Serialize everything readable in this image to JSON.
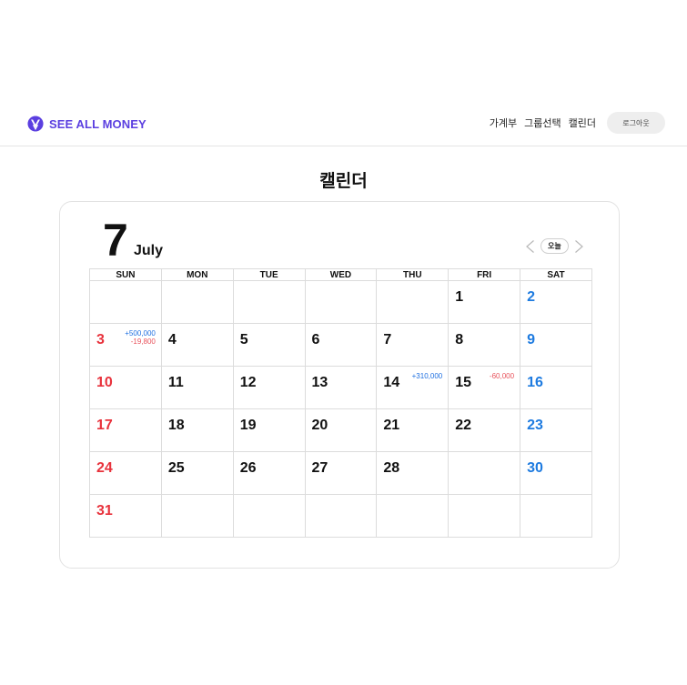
{
  "header": {
    "brand": "SEE ALL MONEY",
    "nav": [
      "가계부",
      "그룹선택",
      "캘린더"
    ],
    "logout_label": "로그아웃",
    "brand_color": "#5b3fe0"
  },
  "page_title": "캘린더",
  "calendar": {
    "month_number": "7",
    "month_name": "July",
    "today_label": "오늘",
    "weekdays": [
      "SUN",
      "MON",
      "TUE",
      "WED",
      "THU",
      "FRI",
      "SAT"
    ],
    "weeks": [
      [
        {
          "day": ""
        },
        {
          "day": ""
        },
        {
          "day": ""
        },
        {
          "day": ""
        },
        {
          "day": ""
        },
        {
          "day": "1"
        },
        {
          "day": "2"
        }
      ],
      [
        {
          "day": "3",
          "income": "+500,000",
          "expense": "-19,800"
        },
        {
          "day": "4"
        },
        {
          "day": "5"
        },
        {
          "day": "6"
        },
        {
          "day": "7"
        },
        {
          "day": "8"
        },
        {
          "day": "9"
        }
      ],
      [
        {
          "day": "10"
        },
        {
          "day": "11"
        },
        {
          "day": "12"
        },
        {
          "day": "13"
        },
        {
          "day": "14",
          "income": "+310,000"
        },
        {
          "day": "15",
          "expense": "-60,000"
        },
        {
          "day": "16"
        }
      ],
      [
        {
          "day": "17"
        },
        {
          "day": "18"
        },
        {
          "day": "19"
        },
        {
          "day": "20"
        },
        {
          "day": "21"
        },
        {
          "day": "22"
        },
        {
          "day": "23"
        }
      ],
      [
        {
          "day": "24"
        },
        {
          "day": "25"
        },
        {
          "day": "26"
        },
        {
          "day": "27"
        },
        {
          "day": "28"
        },
        {
          "day": ""
        },
        {
          "day": "30"
        }
      ],
      [
        {
          "day": "31"
        },
        {
          "day": ""
        },
        {
          "day": ""
        },
        {
          "day": ""
        },
        {
          "day": ""
        },
        {
          "day": ""
        },
        {
          "day": ""
        }
      ]
    ],
    "colors": {
      "sunday": "#e8323c",
      "saturday": "#1e7be0",
      "income": "#1e6fe0",
      "expense": "#e8515a"
    }
  }
}
